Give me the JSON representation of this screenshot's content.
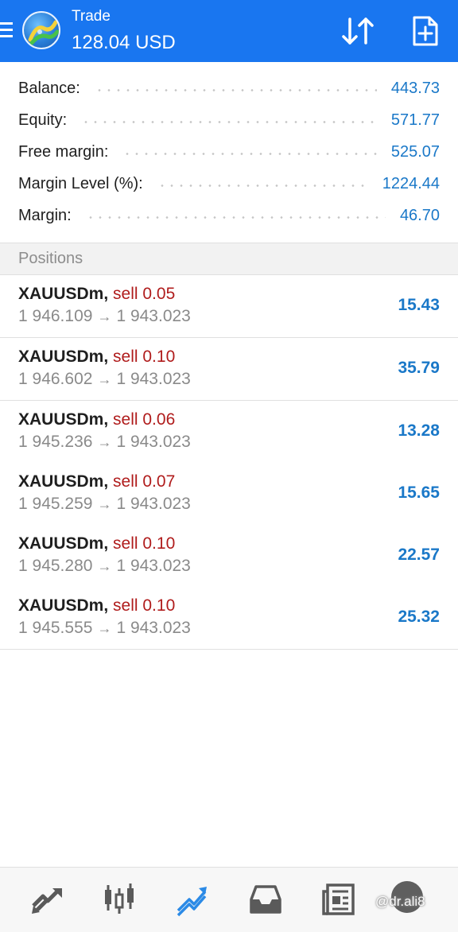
{
  "header": {
    "title": "Trade",
    "balance": "128.04 USD",
    "menu_icon": "hamburger-menu-icon",
    "logo_icon": "metatrader-logo",
    "sort_icon": "sort-arrows-icon",
    "new_order_icon": "new-order-document-icon"
  },
  "summary": {
    "rows": [
      {
        "label": "Balance:",
        "value": "443.73"
      },
      {
        "label": "Equity:",
        "value": "571.77"
      },
      {
        "label": "Free margin:",
        "value": "525.07"
      },
      {
        "label": "Margin Level (%):",
        "value": "1224.44"
      },
      {
        "label": "Margin:",
        "value": "46.70"
      }
    ]
  },
  "positions": {
    "header": "Positions",
    "arrow": "→",
    "items": [
      {
        "symbol": "XAUUSDm,",
        "side": "sell 0.05",
        "open_price": "1 946.109",
        "current_price": "1 943.023",
        "profit": "15.43"
      },
      {
        "symbol": "XAUUSDm,",
        "side": "sell 0.10",
        "open_price": "1 946.602",
        "current_price": "1 943.023",
        "profit": "35.79"
      },
      {
        "symbol": "XAUUSDm,",
        "side": "sell 0.06",
        "open_price": "1 945.236",
        "current_price": "1 943.023",
        "profit": "13.28"
      },
      {
        "symbol": "XAUUSDm,",
        "side": "sell 0.07",
        "open_price": "1 945.259",
        "current_price": "1 943.023",
        "profit": "15.65"
      },
      {
        "symbol": "XAUUSDm,",
        "side": "sell 0.10",
        "open_price": "1 945.280",
        "current_price": "1 943.023",
        "profit": "22.57"
      },
      {
        "symbol": "XAUUSDm,",
        "side": "sell 0.10",
        "open_price": "1 945.555",
        "current_price": "1 943.023",
        "profit": "25.32"
      }
    ]
  },
  "bottom_nav": {
    "items": [
      {
        "icon": "quotes-arrows-icon",
        "active": false
      },
      {
        "icon": "chart-candles-icon",
        "active": false
      },
      {
        "icon": "trade-icon",
        "active": true
      },
      {
        "icon": "history-inbox-icon",
        "active": false
      },
      {
        "icon": "news-icon",
        "active": false
      }
    ],
    "chat_icon": "chat-bubble-icon"
  },
  "watermark": "@dr.ali8",
  "colors": {
    "header_bg": "#1976f0",
    "value_blue": "#1a78c8",
    "sell_red": "#b01c1c",
    "nav_active": "#2b8ae6",
    "nav_inactive": "#5a5a5a"
  }
}
